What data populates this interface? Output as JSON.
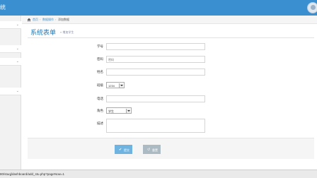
{
  "header": {
    "brand": "统",
    "accent_color": "#3a8fd0",
    "avatar_icon": "user-avatar-icon"
  },
  "sidebar": {
    "items": [
      {
        "icon": "chevron-down-icon",
        "glyph": "⌄"
      },
      {
        "icon": "chevron-down-icon",
        "glyph": "⌄"
      },
      {
        "icon": "chevron-down-icon",
        "glyph": "⌄"
      },
      {
        "icon": "chevron-down-icon",
        "glyph": "⌄"
      }
    ]
  },
  "breadcrumb": {
    "home_icon": "home-icon",
    "items": [
      "首页",
      "数据操作",
      "添加数据"
    ],
    "separator": "›"
  },
  "page": {
    "title": "系统表单",
    "subtitle": "» 增加学生"
  },
  "form": {
    "student_id": {
      "label": "学号",
      "value": "",
      "placeholder": ""
    },
    "password": {
      "label": "密码",
      "value": "",
      "placeholder": "密码"
    },
    "name": {
      "label": "姓名",
      "value": "",
      "placeholder": ""
    },
    "class": {
      "label": "班级",
      "selected": "1234"
    },
    "phone": {
      "label": "电话",
      "value": "",
      "placeholder": ""
    },
    "role": {
      "label": "角色",
      "selected": "学生"
    },
    "notes": {
      "label": "描述",
      "value": ""
    }
  },
  "actions": {
    "submit_label": "提交",
    "submit_icon": "check-icon",
    "reset_label": "重置",
    "reset_icon": "undo-icon"
  },
  "statusbar": {
    "url": "80/stuqj/dashboard/add_stu.php?pageNow=1"
  }
}
